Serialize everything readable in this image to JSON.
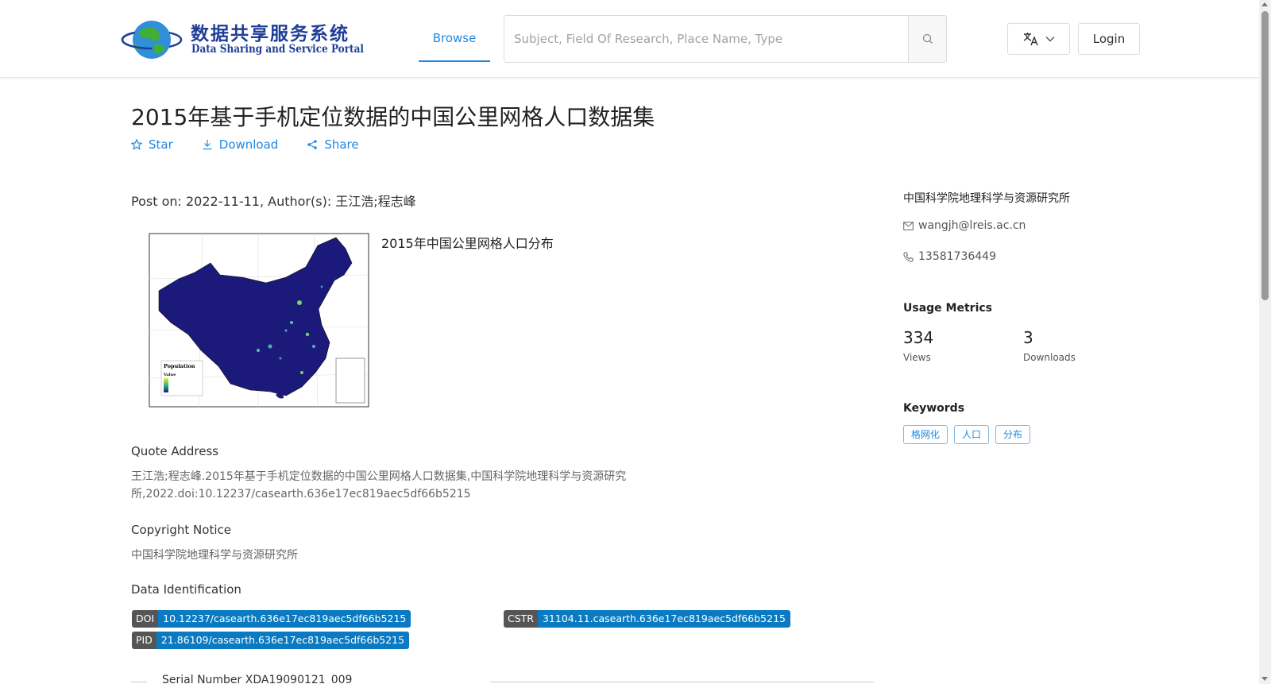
{
  "header": {
    "logo_cn": "数据共享服务系统",
    "logo_en": "Data Sharing and Service Portal",
    "nav_browse": "Browse",
    "search_placeholder": "Subject, Field Of Research, Place Name, Type",
    "login_label": "Login"
  },
  "dataset": {
    "title": "2015年基于手机定位数据的中国公里网格人口数据集",
    "actions": {
      "star": "Star",
      "download": "Download",
      "share": "Share"
    },
    "post_line": "Post on: 2022-11-11, Author(s): 王江浩;程志峰",
    "image_caption": "2015年中国公里网格人口分布",
    "map_legend": {
      "title": "Population",
      "value_label": "Value"
    },
    "sections": {
      "quote": {
        "heading": "Quote Address",
        "text": "王江浩;程志峰.2015年基于手机定位数据的中国公里网格人口数据集,中国科学院地理科学与资源研究所,2022.doi:10.12237/casearth.636e17ec819aec5df66b5215"
      },
      "copyright": {
        "heading": "Copyright Notice",
        "text": "中国科学院地理科学与资源研究所"
      },
      "identification": {
        "heading": "Data Identification",
        "doi": {
          "key": "DOI",
          "value": "10.12237/casearth.636e17ec819aec5df66b5215"
        },
        "cstr": {
          "key": "CSTR",
          "value": "31104.11.casearth.636e17ec819aec5df66b5215"
        },
        "pid": {
          "key": "PID",
          "value": "21.86109/casearth.636e17ec819aec5df66b5215"
        }
      },
      "serial": "Serial Number XDA19090121_009"
    }
  },
  "sidebar": {
    "organization": "中国科学院地理科学与资源研究所",
    "email": "wangjh@lreis.ac.cn",
    "phone": "13581736449",
    "usage_heading": "Usage Metrics",
    "views": {
      "value": "334",
      "label": "Views"
    },
    "downloads": {
      "value": "3",
      "label": "Downloads"
    },
    "keywords_heading": "Keywords",
    "keywords": [
      "格网化",
      "人口",
      "分布"
    ]
  },
  "colors": {
    "accent": "#1e88e5",
    "badge_value": "#0a7bc2",
    "badge_key": "#555555",
    "map_fill": "#1b1a7a"
  }
}
